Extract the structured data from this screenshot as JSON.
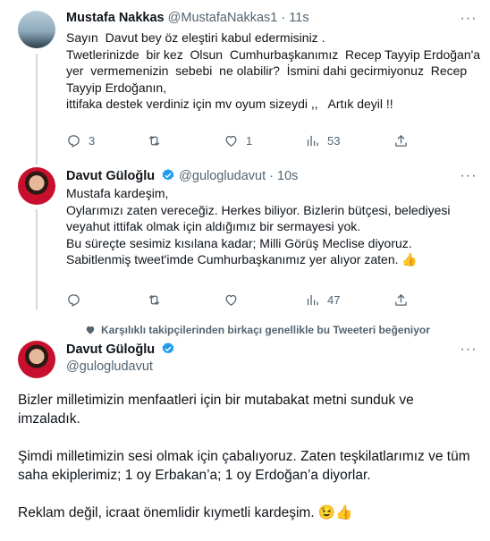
{
  "tweet1": {
    "name": "Mustafa Nakkas",
    "handle": "@MustafaNakkas1",
    "dot": "·",
    "time": "11s",
    "lines": [
      "Sayın  Davut bey öz eleştiri kabul edermisiniz .",
      "",
      "Twetlerinizde  bir kez  Olsun  Cumhurbaşkanımız  Recep Tayyip Erdoğan'a",
      "yer  vermemenizin  sebebi  ne olabilir?  İsmini dahi gecirmiyonuz  Recep",
      "Tayyip Erdoğanın,",
      "ittifaka destek verdiniz için mv oyum sizeydi ,,   Artık deyil !!"
    ],
    "replies": "3",
    "retweets": "",
    "likes": "1",
    "views": "53"
  },
  "tweet2": {
    "name": "Davut Güloğlu",
    "handle": "@gulogludavut",
    "dot": "·",
    "time": "10s",
    "lines": [
      "Mustafa kardeşim,",
      "Oylarımızı zaten vereceğiz. Herkes biliyor. Bizlerin bütçesi, belediyesi",
      "veyahut ittifak olmak için aldığımız bir sermayesi yok.",
      "",
      "Bu süreçte sesimiz kısılana kadar; Milli Görüş Meclise diyoruz.",
      "Sabitlenmiş tweet'imde Cumhurbaşkanımız yer alıyor zaten. 👍"
    ],
    "replies": "",
    "retweets": "",
    "likes": "",
    "views": "47"
  },
  "liked_note": "Karşılıklı takipçilerinden birkaçı genellikle bu Tweeteri beğeniyor",
  "tweet3": {
    "name": "Davut Güloğlu",
    "handle": "@gulogludavut",
    "paragraphs": [
      "Bizler milletimizin menfaatleri için bir mutabakat metni sunduk ve imzaladık.",
      "Şimdi milletimizin sesi olmak için çabalıyoruz. Zaten teşkilatlarımız ve tüm saha ekiplerimiz; 1 oy Erbakan’a; 1 oy Erdoğan’a diyorlar.",
      "Reklam değil, icraat önemlidir kıymetli kardeşim. 😉👍"
    ]
  },
  "colors": {
    "text": "#0f1419",
    "muted": "#536471",
    "verified": "#1d9bf0",
    "line": "#cfd9de"
  }
}
